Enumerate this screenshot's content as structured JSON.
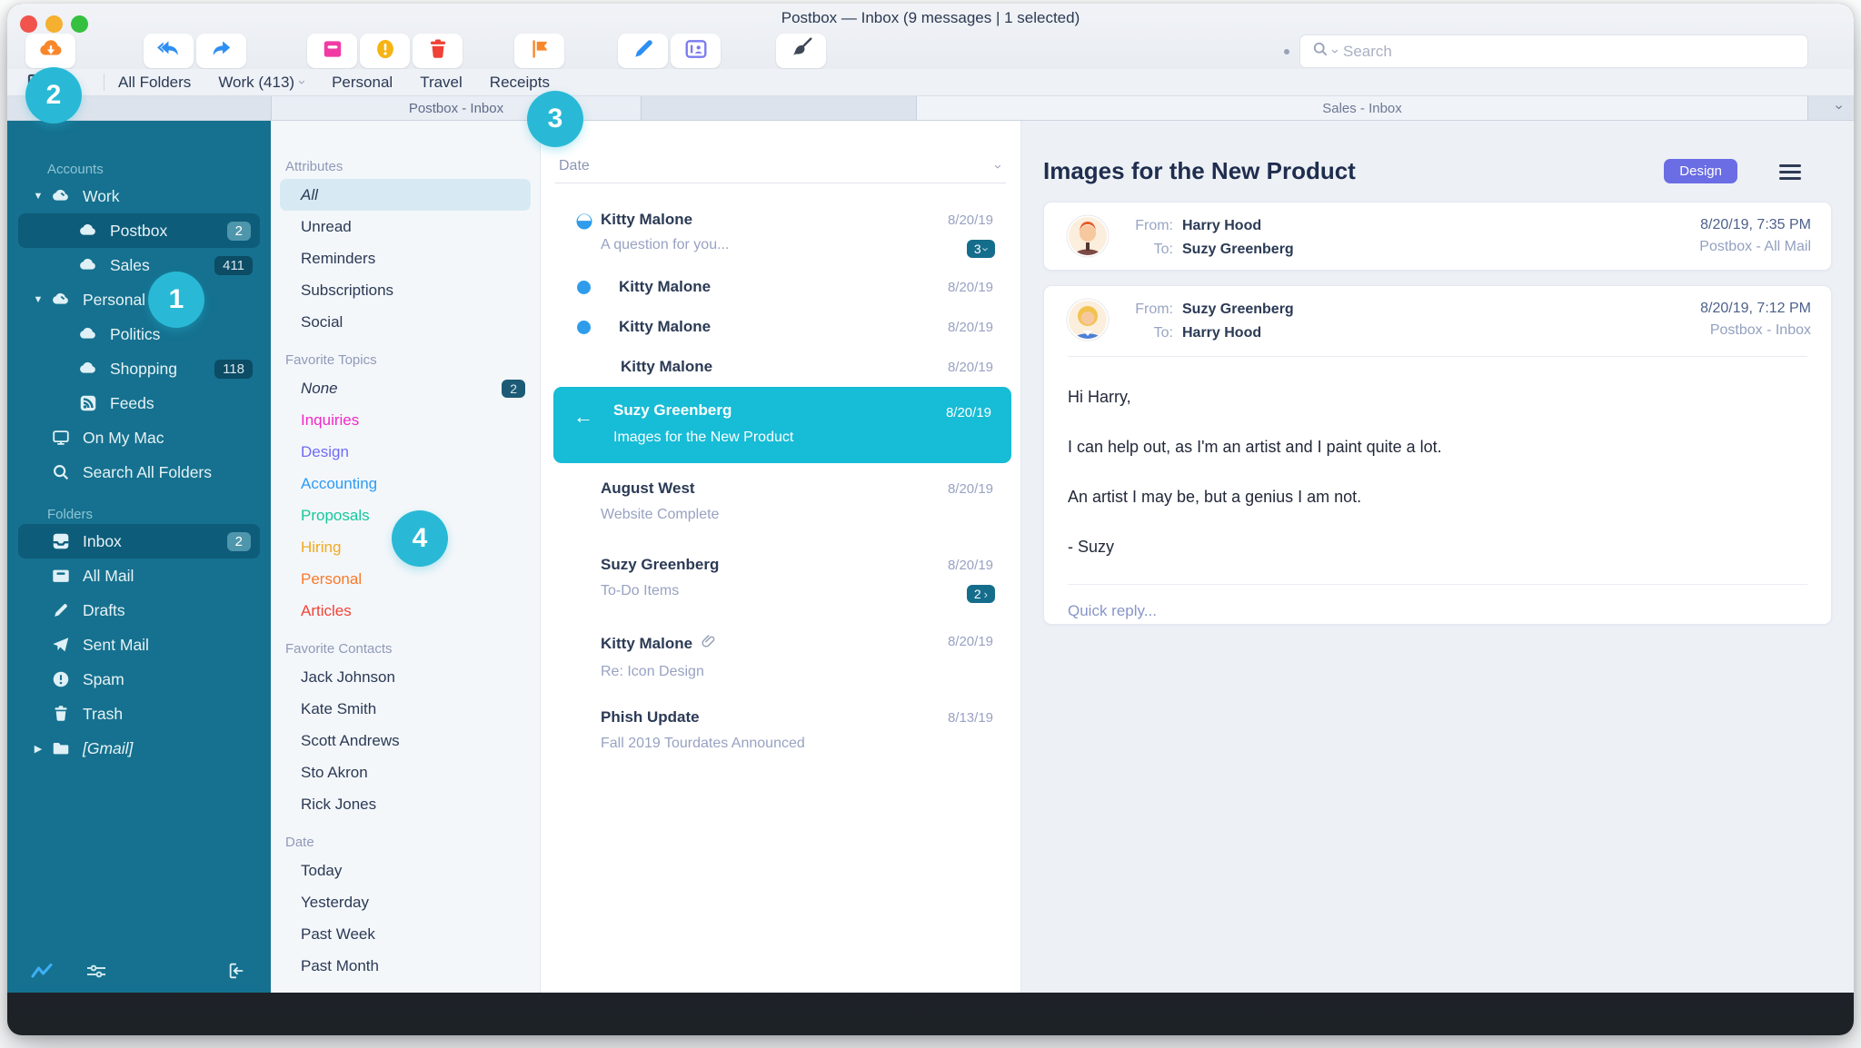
{
  "colors": {
    "sidebar_bg": "#15718f",
    "selected_message": "#17bcd6",
    "annotation": "#29b9d6",
    "design_tag": "#6b6de4",
    "unread_dot": "#2e9ceb"
  },
  "window_title": "Postbox — Inbox (9 messages | 1 selected)",
  "toolbar": {
    "search_placeholder": "Search",
    "buttons": [
      "get-mail",
      "reply-all",
      "forward",
      "archive",
      "spam",
      "delete",
      "tag",
      "compose",
      "contacts",
      "cleanup"
    ]
  },
  "folder_tabs": {
    "items": [
      "All Folders",
      "Work (413)",
      "Personal",
      "Travel",
      "Receipts"
    ]
  },
  "pane_tabs": {
    "left": "Postbox - Inbox",
    "right": "Sales - Inbox"
  },
  "annotations": {
    "a1": "1",
    "a2": "2",
    "a3": "3",
    "a4": "4"
  },
  "sidebar": {
    "accounts_header": "Accounts",
    "accounts": [
      {
        "label": "Work"
      },
      {
        "label": "Postbox",
        "badge": "2"
      },
      {
        "label": "Sales",
        "badge": "411"
      },
      {
        "label": "Personal"
      },
      {
        "label": "Politics"
      },
      {
        "label": "Shopping",
        "badge": "118"
      },
      {
        "label": "Feeds"
      },
      {
        "label": "On My Mac"
      },
      {
        "label": "Search All Folders"
      }
    ],
    "folders_header": "Folders",
    "folders": [
      {
        "label": "Inbox",
        "badge": "2"
      },
      {
        "label": "All Mail"
      },
      {
        "label": "Drafts"
      },
      {
        "label": "Sent Mail"
      },
      {
        "label": "Spam"
      },
      {
        "label": "Trash"
      },
      {
        "label": "[Gmail]"
      }
    ]
  },
  "filters": {
    "attributes_header": "Attributes",
    "attributes": [
      "All",
      "Unread",
      "Reminders",
      "Subscriptions",
      "Social"
    ],
    "topics_header": "Favorite Topics",
    "topics": [
      {
        "label": "None",
        "badge": "2",
        "color": "#2b3a55"
      },
      {
        "label": "Inquiries",
        "color": "#f327c8"
      },
      {
        "label": "Design",
        "color": "#6f6cf2"
      },
      {
        "label": "Accounting",
        "color": "#2d9cf4"
      },
      {
        "label": "Proposals",
        "color": "#16c79a"
      },
      {
        "label": "Hiring",
        "color": "#f2a91e"
      },
      {
        "label": "Personal",
        "color": "#f9792b"
      },
      {
        "label": "Articles",
        "color": "#f24438"
      }
    ],
    "contacts_header": "Favorite Contacts",
    "contacts": [
      "Jack Johnson",
      "Kate Smith",
      "Scott Andrews",
      "Sto Akron",
      "Rick Jones"
    ],
    "date_header": "Date",
    "dates": [
      "Today",
      "Yesterday",
      "Past Week",
      "Past Month"
    ]
  },
  "message_list": {
    "sort_label": "Date",
    "rows": [
      {
        "sender": "Kitty Malone",
        "preview": "A question for you...",
        "date": "8/20/19",
        "badge": "3"
      },
      {
        "sender": "Kitty Malone",
        "date": "8/20/19"
      },
      {
        "sender": "Kitty Malone",
        "date": "8/20/19"
      },
      {
        "sender": "Kitty Malone",
        "date": "8/20/19"
      },
      {
        "sender": "Suzy Greenberg",
        "preview": "Images for the New Product",
        "date": "8/20/19"
      },
      {
        "sender": "August West",
        "preview": "Website Complete",
        "date": "8/20/19"
      },
      {
        "sender": "Suzy Greenberg",
        "preview": "To-Do Items",
        "date": "8/20/19",
        "badge": "2"
      },
      {
        "sender": "Kitty Malone",
        "preview": "Re: Icon Design",
        "date": "8/20/19"
      },
      {
        "sender": "Phish Update",
        "preview": "Fall 2019 Tourdates Announced",
        "date": "8/13/19"
      }
    ]
  },
  "reading": {
    "title": "Images for the New Product",
    "tag": "Design",
    "from_label": "From:",
    "to_label": "To:",
    "messages": [
      {
        "from": "Harry Hood",
        "to": "Suzy Greenberg",
        "datetime": "8/20/19, 7:35 PM",
        "folder": "Postbox - All Mail"
      },
      {
        "from": "Suzy Greenberg",
        "to": "Harry Hood",
        "datetime": "8/20/19, 7:12 PM",
        "folder": "Postbox - Inbox"
      }
    ],
    "body": [
      "Hi Harry,",
      "I can help out, as I'm an artist and I paint quite a lot.",
      "An artist I may be, but a genius I am not.",
      "- Suzy"
    ],
    "quick_reply": "Quick reply..."
  }
}
